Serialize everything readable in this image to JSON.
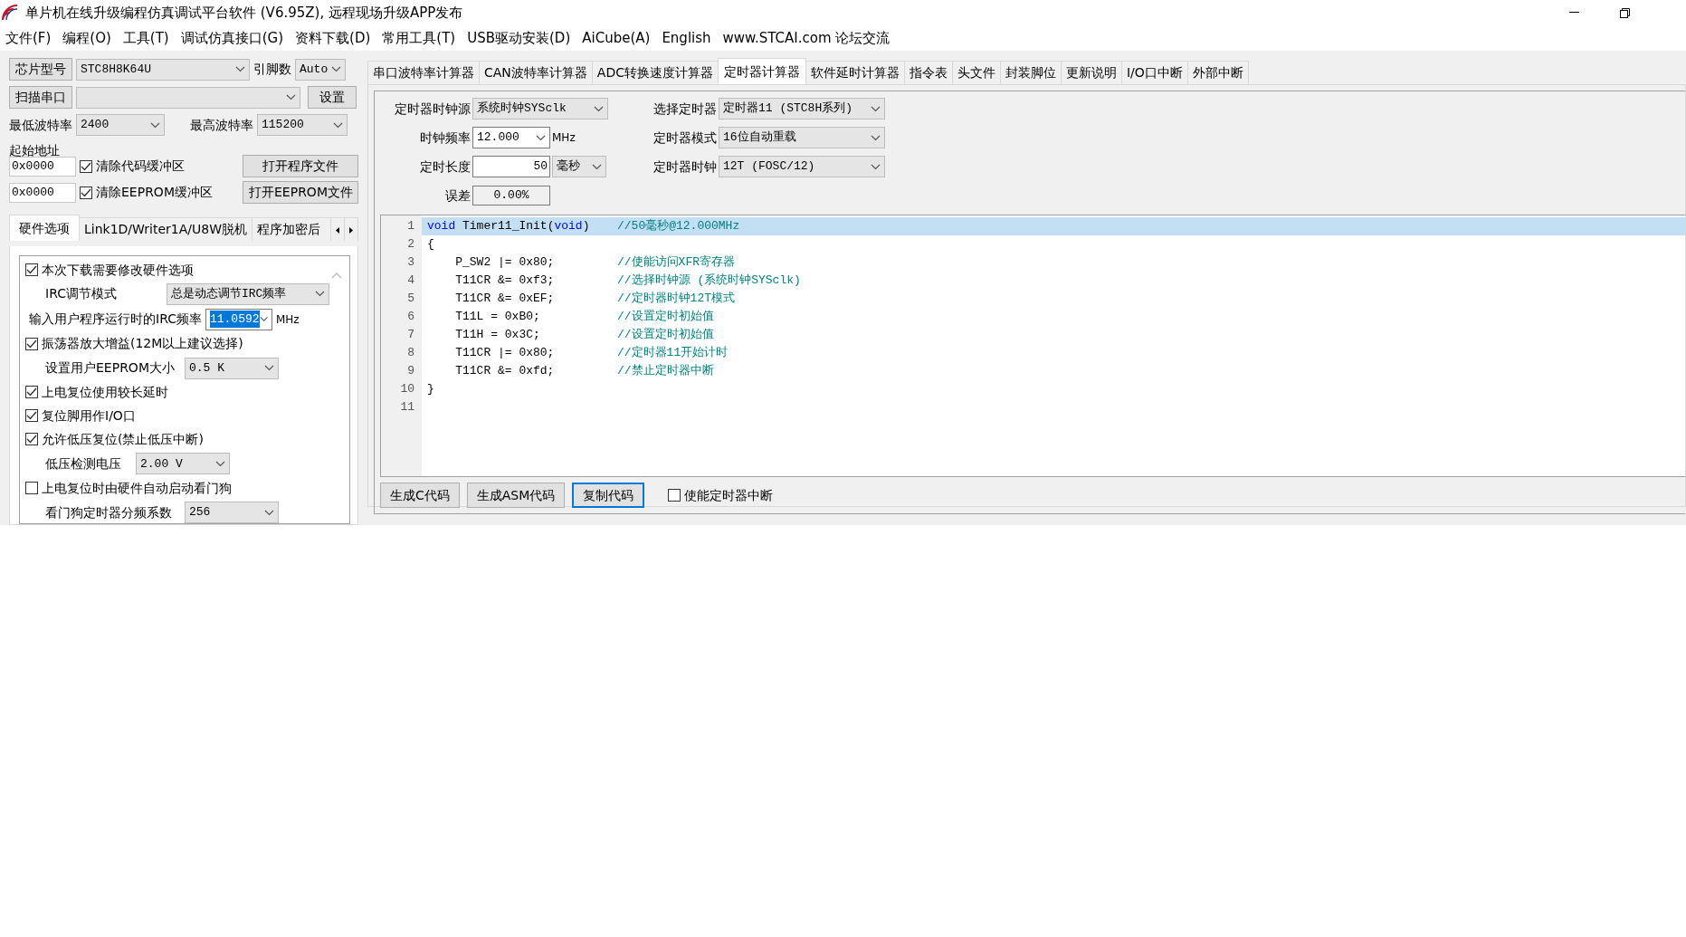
{
  "window": {
    "title": "单片机在线升级编程仿真调试平台软件 (V6.95Z), 远程现场升级APP发布"
  },
  "menu": [
    "文件(F)",
    "编程(O)",
    "工具(T)",
    "调试仿真接口(G)",
    "资料下载(D)",
    "常用工具(T)",
    "USB驱动安装(D)",
    "AiCube(A)",
    "English",
    "www.STCAI.com 论坛交流"
  ],
  "left": {
    "chip_button": "芯片型号",
    "chip_value": "STC8H8K64U",
    "pins_label": "引脚数",
    "pins_value": "Auto",
    "scan_button": "扫描串口",
    "settings_button": "设置",
    "min_baud_label": "最低波特率",
    "min_baud_value": "2400",
    "max_baud_label": "最高波特率",
    "max_baud_value": "115200",
    "start_address_label": "起始地址",
    "address_rows": [
      {
        "address": "0x0000",
        "checkbox": "清除代码缓冲区",
        "checked": true,
        "button": "打开程序文件"
      },
      {
        "address": "0x0000",
        "checkbox": "清除EEPROM缓冲区",
        "checked": true,
        "button": "打开EEPROM文件"
      }
    ],
    "tabs": [
      {
        "label": "硬件选项",
        "selected": true
      },
      {
        "label": "Link1D/Writer1A/U8W脱机",
        "selected": false
      },
      {
        "label": "程序加密后",
        "selected": false
      }
    ],
    "options": [
      {
        "kind": "checkbox",
        "label": "本次下载需要修改硬件选项",
        "checked": true
      },
      {
        "kind": "combo",
        "label": "IRC调节模式",
        "value": "总是动态调节IRC频率"
      },
      {
        "kind": "input",
        "label": "输入用户程序运行时的IRC频率",
        "value": "11.0592",
        "unit": "MHz",
        "text_selected": true
      },
      {
        "kind": "checkbox",
        "label": "振荡器放大增益(12M以上建议选择)",
        "checked": true
      },
      {
        "kind": "combo",
        "label": "设置用户EEPROM大小",
        "value": "0.5 K"
      },
      {
        "kind": "checkbox",
        "label": "上电复位使用较长延时",
        "checked": true
      },
      {
        "kind": "checkbox",
        "label": "复位脚用作I/O口",
        "checked": true
      },
      {
        "kind": "checkbox",
        "label": "允许低压复位(禁止低压中断)",
        "checked": true
      },
      {
        "kind": "combo",
        "label": "低压检测电压",
        "value": "2.00 V"
      },
      {
        "kind": "checkbox",
        "label": "上电复位时由硬件自动启动看门狗",
        "checked": false
      },
      {
        "kind": "combo",
        "label": "看门狗定时器分频系数",
        "value": "256"
      }
    ]
  },
  "right": {
    "tabs": [
      {
        "label": "串口波特率计算器",
        "selected": false
      },
      {
        "label": "CAN波特率计算器",
        "selected": false
      },
      {
        "label": "ADC转换速度计算器",
        "selected": false
      },
      {
        "label": "定时器计算器",
        "selected": true
      },
      {
        "label": "软件延时计算器",
        "selected": false
      },
      {
        "label": "指令表",
        "selected": false
      },
      {
        "label": "头文件",
        "selected": false
      },
      {
        "label": "封装脚位",
        "selected": false
      },
      {
        "label": "更新说明",
        "selected": false
      },
      {
        "label": "I/O口中断",
        "selected": false
      },
      {
        "label": "外部中断",
        "selected": false
      }
    ],
    "clock_source": {
      "label": "定时器时钟源",
      "value": "系统时钟SYSclk"
    },
    "clock_freq": {
      "label": "时钟频率",
      "value": "12.000",
      "unit": "MHz"
    },
    "duration": {
      "label": "定时长度",
      "value": "50",
      "unit": "毫秒"
    },
    "error": {
      "label": "误差",
      "value": "0.00%"
    },
    "timer": {
      "label": "选择定时器",
      "value": "定时器11 (STC8H系列)"
    },
    "mode": {
      "label": "定时器模式",
      "value": "16位自动重载"
    },
    "timer_clock": {
      "label": "定时器时钟",
      "value": "12T (FOSC/12)"
    },
    "code_lines": [
      {
        "number": "1",
        "selected": true,
        "segments": [
          {
            "kind": "keyword",
            "text": "void"
          },
          {
            "kind": "plain",
            "text": " Timer11_Init("
          },
          {
            "kind": "keyword",
            "text": "void"
          },
          {
            "kind": "plain",
            "text": ")"
          }
        ],
        "comment": "//50毫秒@12.000MHz"
      },
      {
        "number": "2",
        "selected": false,
        "segments": [
          {
            "kind": "plain",
            "text": "{"
          }
        ]
      },
      {
        "number": "3",
        "selected": false,
        "segments": [
          {
            "kind": "plain",
            "text": "    P_SW2 |= 0x80;"
          }
        ],
        "comment": "//使能访问XFR寄存器"
      },
      {
        "number": "4",
        "selected": false,
        "segments": [
          {
            "kind": "plain",
            "text": "    T11CR &= 0xf3;"
          }
        ],
        "comment": "//选择时钟源 (系统时钟SYSclk)"
      },
      {
        "number": "5",
        "selected": false,
        "segments": [
          {
            "kind": "plain",
            "text": "    T11CR &= 0xEF;"
          }
        ],
        "comment": "//定时器时钟12T模式"
      },
      {
        "number": "6",
        "selected": false,
        "segments": [
          {
            "kind": "plain",
            "text": "    T11L = 0xB0;"
          }
        ],
        "comment": "//设置定时初始值"
      },
      {
        "number": "7",
        "selected": false,
        "segments": [
          {
            "kind": "plain",
            "text": "    T11H = 0x3C;"
          }
        ],
        "comment": "//设置定时初始值"
      },
      {
        "number": "8",
        "selected": false,
        "segments": [
          {
            "kind": "plain",
            "text": "    T11CR |= 0x80;"
          }
        ],
        "comment": "//定时器11开始计时"
      },
      {
        "number": "9",
        "selected": false,
        "segments": [
          {
            "kind": "plain",
            "text": "    T11CR &= 0xfd;"
          }
        ],
        "comment": "//禁止定时器中断"
      },
      {
        "number": "10",
        "selected": false,
        "segments": [
          {
            "kind": "plain",
            "text": "}"
          }
        ]
      },
      {
        "number": "11",
        "selected": false
      }
    ],
    "buttons": [
      {
        "label": "生成C代码",
        "focused": false
      },
      {
        "label": "生成ASM代码",
        "focused": false
      },
      {
        "label": "复制代码",
        "focused": true
      }
    ],
    "interrupt_checkbox": {
      "label": "使能定时器中断",
      "checked": false
    }
  }
}
